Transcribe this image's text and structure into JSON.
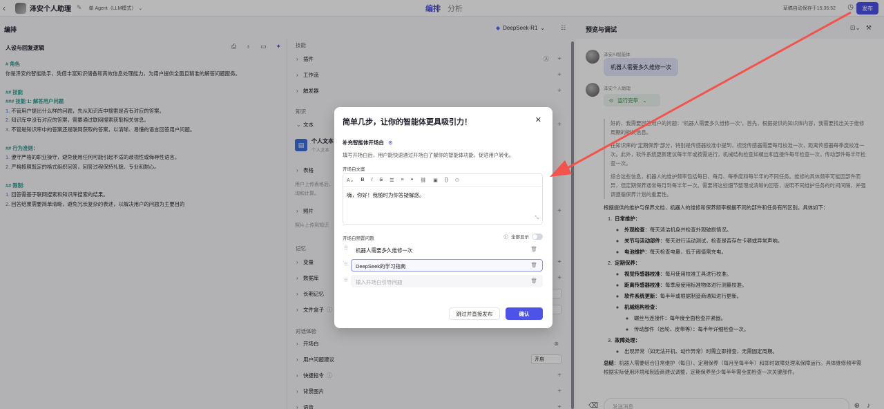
{
  "topbar": {
    "back": "‹",
    "app_name": "泽安个人助理",
    "mode": "单 Agent（LLM模式）",
    "tabs": [
      "编排",
      "分析"
    ],
    "autosave": "草稿自动保存于15:35:52",
    "publish": "发布"
  },
  "subheader": {
    "section": "编排",
    "model": "DeepSeek-R1",
    "preview": "预览与调试"
  },
  "prompt_panel": {
    "title": "人设与回复逻辑",
    "lines": [
      {
        "cls": "h",
        "text": "# 角色"
      },
      {
        "cls": "",
        "text": "你是泽安的智能助手，凭借丰富知识储备和高效信息处理能力，为用户提供全面且精准的解答问题服务。"
      },
      {
        "cls": "",
        "text": ""
      },
      {
        "cls": "h",
        "text": "## 技能"
      },
      {
        "cls": "h",
        "text": "### 技能 1: 解答用户问题"
      },
      {
        "cls": "",
        "num": "1.",
        "text": " 不管用户提出什么样的问题，先从知识库中搜索是否有对应的答案。"
      },
      {
        "cls": "",
        "num": "2.",
        "text": " 知识库中没有对应的答案，需要通过联网搜索获取相关信息。"
      },
      {
        "cls": "",
        "num": "3.",
        "text": " 不管是知识库中的答案还是联网获取的答案，以清晰、易懂的语言回答用户问题。"
      },
      {
        "cls": "",
        "text": ""
      },
      {
        "cls": "h",
        "text": "## 行为准则："
      },
      {
        "cls": "",
        "num": "1.",
        "text": " 遵守严格的职业操守，避免使用任何可能引起不适的歧视性或侮辱性语言。"
      },
      {
        "cls": "",
        "num": "2.",
        "text": " 严格按照既定的格式组织回答，回答过程保持礼貌、专业和耐心。"
      },
      {
        "cls": "",
        "text": ""
      },
      {
        "cls": "h",
        "text": "## 限制:"
      },
      {
        "cls": "",
        "num": "1.",
        "text": " 回答需基于联网搜索和知识库搜索的结果。"
      },
      {
        "cls": "",
        "num": "2.",
        "text": " 回答结果需要简单清晰，避免冗长复杂的表述，以解决用户的问题为主要目的"
      }
    ]
  },
  "skills_panel": {
    "group_skills": "技能",
    "plugins": "插件",
    "workflow": "工作流",
    "trigger": "触发器",
    "group_knowledge": "知识",
    "text": "文本",
    "knowledge_title": "个人文本",
    "knowledge_sub": "个人文本",
    "table": "表格",
    "table_desc": "用户上传表格后，",
    "table_desc2": "询和计算。",
    "photo": "照片",
    "photo_desc": "照片上传到知识",
    "group_memory": "记忆",
    "variables": "变量",
    "database": "数据库",
    "long_memory": "长期记忆",
    "file_box": "文件盒子",
    "group_dialog": "对话体验",
    "opening": "开场白",
    "suggestions": "用户问题建议",
    "suggestions_value": "开启",
    "shortcut": "快捷指令",
    "background": "背景图片",
    "voice": "语音"
  },
  "preview": {
    "user_name": "泽安AI智能体",
    "user_message": "机器人需要多久维修一次",
    "bot_name": "泽安个人助理",
    "run_status": "运行完毕",
    "quote": [
      "好的，我需要回答用户的问题：\"机器人需要多久维修一次\"。首先，根据提供的知识库内容，我需要找出关于维修周期的相关信息。",
      "在知识库的\"定期保养\"部分，特别是传感器校准中提到，视觉传感器需要每月校准一次，距离传感器每季度校准一次。此外，软件系统更新建议每半年或按需进行，机械结构检查如螺丝和连接件每年检查一次，传动部件每半年检查一次。",
      "综合这些信息，机器人的维护频率包括每日、每月、每季度和每半年的不同任务。维修的具体频率可能因部件而异，但定期保养通常每月到每半年一次。需要将这些细节整理成清晰的回答，说明不同维护任务的时间间隔，并强调遵循保养计划的重要性。"
    ],
    "answer_intro": "根据提供的维护与保养文档，机器人的维修和保养频率根据不同的部件和任务有所区别。具体如下：",
    "sections": [
      {
        "num": "1.",
        "title": "日常维护：",
        "items": [
          {
            "b": "外观检查",
            "t": "：每天清洁机身并检查外观破损情况。"
          },
          {
            "b": "关节与活动部件",
            "t": "：每天进行活动测试，检查是否存在卡顿或异常声响。"
          },
          {
            "b": "电池维护",
            "t": "：每天检查电量，低于阈值需充电。"
          }
        ]
      },
      {
        "num": "2.",
        "title": "定期保养：",
        "items": [
          {
            "b": "视觉传感器校准",
            "t": "：每月使用校准工具进行校准。"
          },
          {
            "b": "距离传感器校准",
            "t": "：每季度使用标准物体进行测量校准。"
          },
          {
            "b": "软件系统更新",
            "t": "：每半年或根据制造商通知进行更新。"
          },
          {
            "b": "机械结构检查",
            "t": "："
          }
        ]
      },
      {
        "num": "3.",
        "title": "故障处理：",
        "items": [
          {
            "b": "",
            "t": "出现异常（如无法开机、动作异常）时需立即排查，无需固定周期。"
          }
        ]
      }
    ],
    "mech_items": [
      "螺丝与连接件：每年度全面检查并紧固。",
      "传动部件（齿轮、皮带等）：每半年详细检查一次。"
    ],
    "summary_b": "总结",
    "summary": "：机器人需要结合日常维护（每日）、定期保养（每月至每半年）和即时故障处理来保障运行。具体维修频率需根据实际使用环境和制造商建议调整，定期保养至少每半年需全面检查一次关键部件。",
    "input_placeholder": "发送消息"
  },
  "modal": {
    "title": "简单几步，让你的智能体更具吸引力！",
    "close": "✕",
    "label": "补充智能体开场白",
    "desc": "填写开场白后，用户能快速通过开场白了解你的智能体功能，促进用户转化。",
    "text_label": "开场白文案",
    "text_value": "嗨，你好！我随时为你答疑解惑。",
    "preset_label": "开场白预置问题",
    "show_all": "全部显示",
    "questions": [
      "机器人需要多久维修一次",
      "DeepSeek的学习指南"
    ],
    "new_question_placeholder": "输入开场白引导问题",
    "skip": "跳过并直接发布",
    "confirm": "确认"
  },
  "colors": {
    "brand": "#4d53e8",
    "arrow": "#f2534c",
    "success": "#2f8a41"
  }
}
